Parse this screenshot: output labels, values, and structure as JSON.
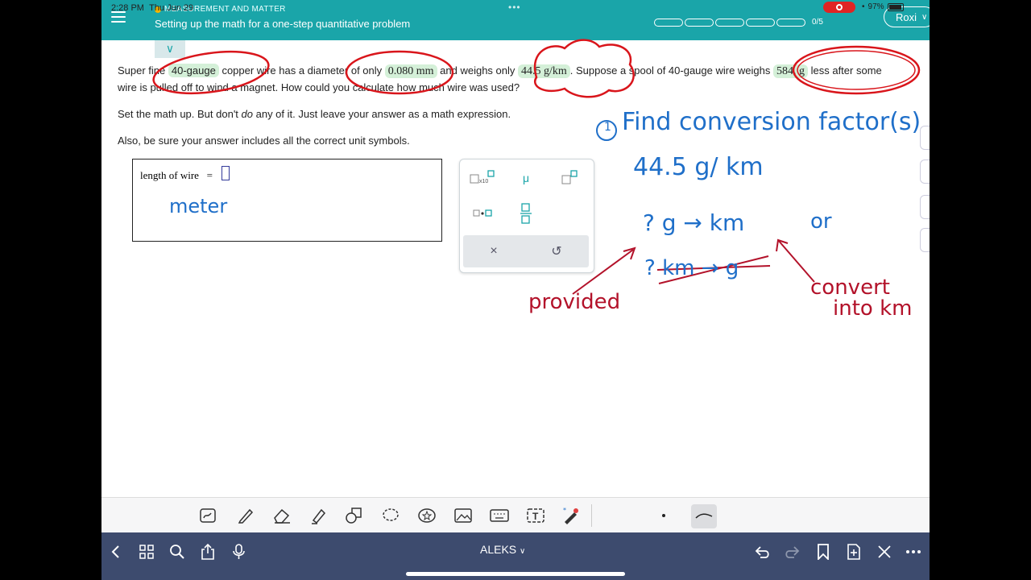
{
  "status": {
    "time": "2:28 PM",
    "date": "Thu Jun 29",
    "battery": "97%"
  },
  "header": {
    "topic": "MEASUREMENT AND MATTER",
    "lesson_title": "Setting up the math for a one-step quantitative problem",
    "progress_label": "0/5",
    "progress_segments": 5,
    "progress_completed": 0,
    "user_name": "Roxi",
    "accent_color": "#1aa5a9"
  },
  "problem": {
    "s1": "Super fine ",
    "gauge": "40-gauge",
    "s2": " copper wire has a diameter of only ",
    "diameter": "0.080",
    "diameter_unit": "mm",
    "s3": " and weighs only ",
    "weight_rate": "44.5",
    "weight_rate_unit": "g/km",
    "s4": ". Suppose a spool of 40-gauge wire weighs ",
    "spool_loss": "584.",
    "spool_unit": "g",
    "s5": " less after some wire is pulled off to wind a magnet. How could you calculate how much wire was used?",
    "line2a": "Set the math up. But don't ",
    "line2_em": "do",
    "line2b": " any of it. Just leave your answer as a math expression.",
    "line3": "Also, be sure your answer includes all the correct unit symbols."
  },
  "answer": {
    "label": "length of wire",
    "equals": "="
  },
  "palette": {
    "mu": "μ",
    "clear": "×",
    "undo": "↺"
  },
  "annotations": {
    "step": "Find conversion factor(s)",
    "step_number": "1",
    "rate": "44.5 g/ km",
    "unit_note": "meter",
    "arrow_q": "? g → km",
    "or": "or",
    "crossed": "? km → g",
    "provided": "provided",
    "convert1": "convert",
    "convert2": "into km",
    "blue_color": "#1f6fc9",
    "red_color": "#b3122a"
  },
  "bottom_nav": {
    "app_name": "ALEKS",
    "bar_color": "#3d4b6e"
  }
}
